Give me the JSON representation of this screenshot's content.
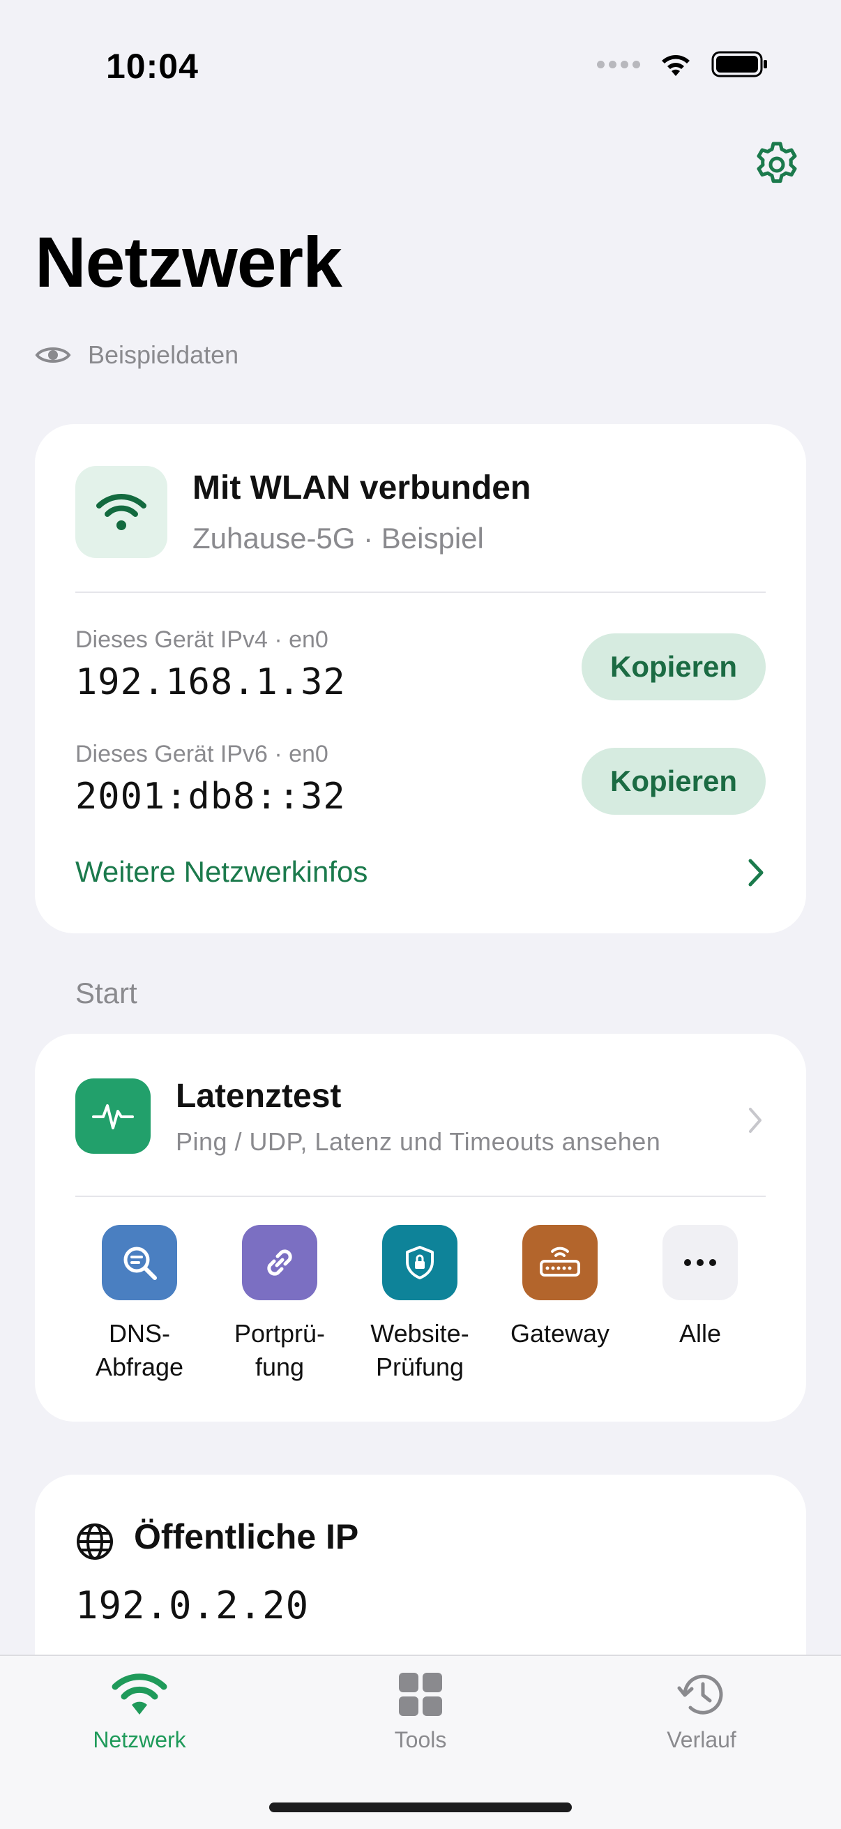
{
  "status_bar": {
    "time": "10:04"
  },
  "header": {
    "title": "Netzwerk",
    "sample_label": "Beispieldaten"
  },
  "connection": {
    "title": "Mit WLAN verbunden",
    "subtitle": "Zuhause-5G · Beispiel",
    "ipv4": {
      "label": "Dieses Gerät IPv4 · en0",
      "value": "192.168.1.32",
      "button": "Kopieren"
    },
    "ipv6": {
      "label": "Dieses Gerät IPv6 · en0",
      "value": "2001:db8::32",
      "button": "Kopieren"
    },
    "more_link": "Weitere Netzwerkinfos"
  },
  "start": {
    "section_label": "Start",
    "latency": {
      "title": "Latenztest",
      "subtitle": "Ping / UDP, Latenz und Timeouts ansehen"
    },
    "tools": [
      {
        "label_line1": "DNS-",
        "label_line2": "Abfrage",
        "icon": "dns-search-icon",
        "color": "#4a7fc1"
      },
      {
        "label_line1": "Portprü-",
        "label_line2": "fung",
        "icon": "link-icon",
        "color": "#7b6fc2"
      },
      {
        "label_line1": "Website-",
        "label_line2": "Prüfung",
        "icon": "shield-lock-icon",
        "color": "#0e8399"
      },
      {
        "label_line1": "Gateway",
        "label_line2": "",
        "icon": "router-icon",
        "color": "#b3652c"
      },
      {
        "label_line1": "Alle",
        "label_line2": "",
        "icon": "more-icon",
        "color": "#f0f0f4"
      }
    ]
  },
  "public_ip": {
    "title": "Öffentliche IP",
    "value": "192.0.2.20"
  },
  "tabbar": {
    "tabs": [
      {
        "label": "Netzwerk",
        "active": true
      },
      {
        "label": "Tools",
        "active": false
      },
      {
        "label": "Verlauf",
        "active": false
      }
    ]
  },
  "colors": {
    "accent": "#1b7a4c",
    "active_tab": "#1f9a5a",
    "inactive_tab": "#8a8a8e"
  }
}
